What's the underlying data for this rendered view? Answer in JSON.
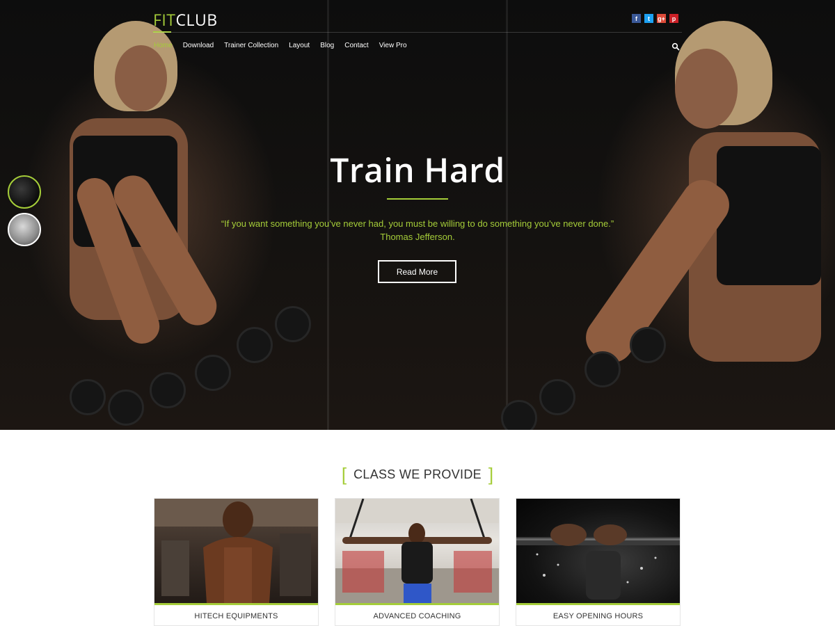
{
  "brand": {
    "part1": "FIT",
    "part2": "CLUB"
  },
  "social": [
    {
      "icon": "facebook-icon",
      "glyph": "f"
    },
    {
      "icon": "twitter-icon",
      "glyph": "t"
    },
    {
      "icon": "google-plus-icon",
      "glyph": "g+"
    },
    {
      "icon": "pinterest-icon",
      "glyph": "p"
    }
  ],
  "nav": {
    "items": [
      "Home",
      "Download",
      "Trainer Collection",
      "Layout",
      "Blog",
      "Contact",
      "View Pro"
    ],
    "active": "Home"
  },
  "hero": {
    "title": "Train Hard",
    "quote": "“If you want something you’ve never had, you must be willing to do something you’ve never done.”",
    "author": "Thomas Jefferson.",
    "button": "Read More"
  },
  "classes": {
    "heading": "CLASS WE PROVIDE",
    "bracket_open": "[",
    "bracket_close": "]",
    "items": [
      {
        "label": "HITECH EQUIPMENTS"
      },
      {
        "label": "ADVANCED COACHING"
      },
      {
        "label": "EASY OPENING HOURS"
      }
    ]
  },
  "colors": {
    "accent": "#a5cd39",
    "text_dark": "#333333"
  }
}
